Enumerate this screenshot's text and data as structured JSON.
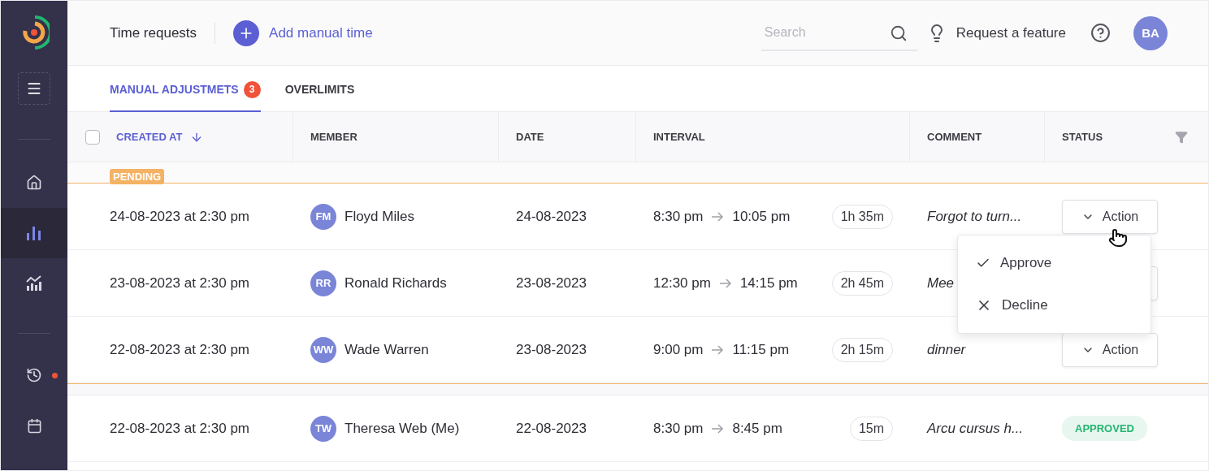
{
  "sidebar": {
    "items": [
      {
        "kind": "home",
        "selected": false,
        "dot": false
      },
      {
        "kind": "bars",
        "selected": true,
        "dot": false
      },
      {
        "kind": "analytics",
        "selected": false,
        "dot": false
      },
      {
        "kind": "divider"
      },
      {
        "kind": "history",
        "selected": false,
        "dot": true
      },
      {
        "kind": "calendar",
        "selected": false,
        "dot": false
      }
    ]
  },
  "header": {
    "title": "Time requests",
    "add_button": "Add manual time",
    "search": {
      "placeholder": "Search"
    },
    "feature_link": "Request a feature",
    "avatar": "BA"
  },
  "tabs": [
    {
      "label": "MANUAL ADJUSTMETS",
      "count": "3",
      "selected": true
    },
    {
      "label": "OVERLIMITS",
      "selected": false
    }
  ],
  "table": {
    "select_all": {
      "checked": false
    },
    "columns": [
      {
        "label": "CREATED AT",
        "sorted": true
      },
      {
        "label": "MEMBER",
        "sorted": false
      },
      {
        "label": "DATE",
        "sorted": false
      },
      {
        "label": "INTERVAL",
        "sorted": false
      },
      {
        "label": "COMMENT",
        "sorted": false
      },
      {
        "label": "STATUS",
        "sorted": false,
        "filter": true
      }
    ],
    "groups": [
      {
        "label": "PENDING",
        "rows": [
          {
            "created": "24-08-2023 at 2:30 pm",
            "member": {
              "initials": "FM",
              "name": "Floyd Miles"
            },
            "date": "24-08-2023",
            "start": "8:30 pm",
            "end": "10:05 pm",
            "duration": "1h 35m",
            "comment": "Forgot to turn...",
            "status": {
              "kind": "action",
              "label": "Action",
              "menu": {
                "items": [
                  {
                    "kind": "approve",
                    "label": "Approve"
                  },
                  {
                    "kind": "decline",
                    "label": "Decline"
                  }
                ]
              }
            }
          },
          {
            "created": "23-08-2023 at 2:30 pm",
            "member": {
              "initials": "RR",
              "name": "Ronald Richards"
            },
            "date": "23-08-2023",
            "start": "12:30 pm",
            "end": "14:15 pm",
            "duration": "2h 45m",
            "comment": "Mee",
            "status": {
              "kind": "covered"
            }
          },
          {
            "created": "22-08-2023 at 2:30 pm",
            "member": {
              "initials": "WW",
              "name": "Wade Warren"
            },
            "date": "23-08-2023",
            "start": "9:00 pm",
            "end": "11:15 pm",
            "duration": "2h 15m",
            "comment": "dinner",
            "status": {
              "kind": "action",
              "label": "Action"
            }
          }
        ]
      },
      {
        "rows": [
          {
            "created": "22-08-2023 at 2:30 pm",
            "member": {
              "initials": "TW",
              "name": "Theresa Web (Me)"
            },
            "date": "22-08-2023",
            "start": "8:30 pm",
            "end": "8:45 pm",
            "duration": "15m",
            "comment": "Arcu cursus h...",
            "status": {
              "kind": "approved",
              "label": "APPROVED"
            }
          }
        ]
      }
    ]
  }
}
